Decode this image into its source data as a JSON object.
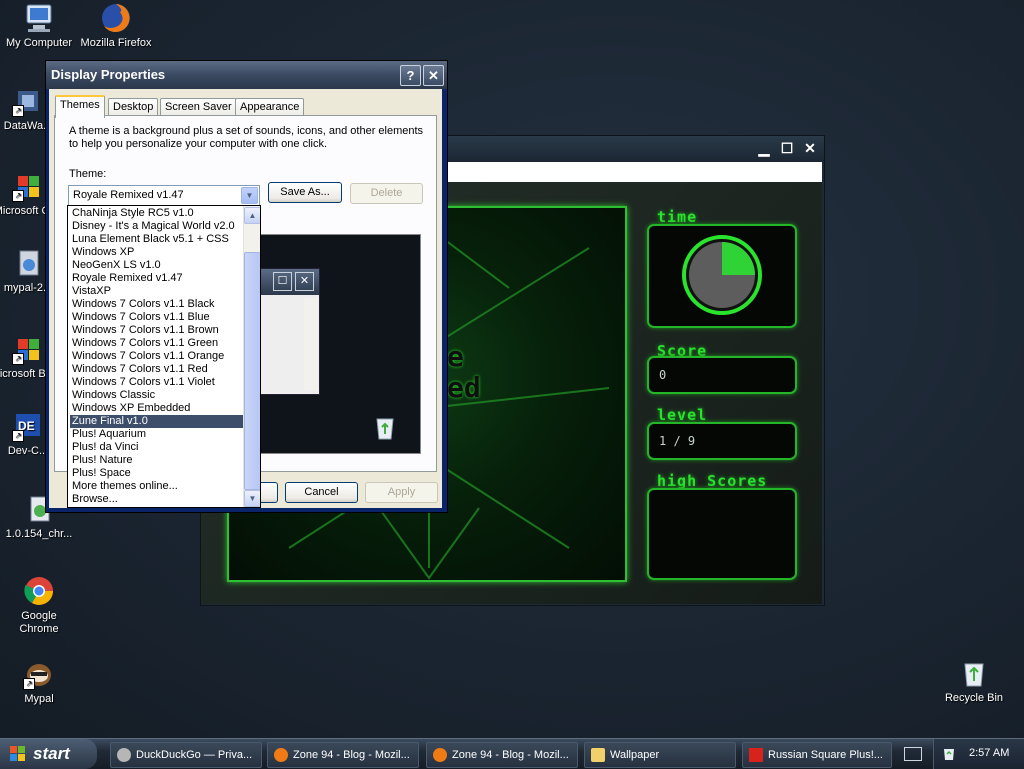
{
  "desktop": {
    "icons": [
      {
        "label": "My Computer"
      },
      {
        "label": "Mozilla Firefox"
      },
      {
        "label": "DataWa..."
      },
      {
        "label": "Microsoft C++"
      },
      {
        "label": "mypal-2..."
      },
      {
        "label": "Microsoft Basic"
      },
      {
        "label": "Dev-C..."
      },
      {
        "label": "1.0.154_chr..."
      },
      {
        "label": "Google Chrome"
      },
      {
        "label": "Mypal"
      },
      {
        "label": "Recycle Bin"
      }
    ]
  },
  "game": {
    "board_text": [
      "e",
      "ed"
    ],
    "time_label": "time",
    "score_label": "Score",
    "score_value": "0",
    "level_label": "level",
    "level_value": "1 / 9",
    "highscores_label": "high Scores"
  },
  "dialog": {
    "title": "Display Properties",
    "help_btn": "?",
    "close_btn": "✕",
    "tabs": [
      "Themes",
      "Desktop",
      "Screen Saver",
      "Appearance"
    ],
    "description": "A theme is a background plus a set of sounds, icons, and other elements to help you personalize your computer with one click.",
    "theme_label": "Theme:",
    "theme_value": "Royale Remixed v1.47",
    "save_as": "Save As...",
    "delete": "Delete",
    "ok": "OK",
    "cancel": "Cancel",
    "apply": "Apply"
  },
  "dropdown": {
    "items": [
      "ChaNinja Style RC5 v1.0",
      "Disney - It's a Magical World v2.0",
      "Luna Element Black v5.1 + CSS",
      "Windows XP",
      "NeoGenX LS v1.0",
      "Royale Remixed v1.47",
      "VistaXP",
      "Windows 7 Colors v1.1 Black",
      "Windows 7 Colors v1.1 Blue",
      "Windows 7 Colors v1.1 Brown",
      "Windows 7 Colors v1.1 Green",
      "Windows 7 Colors v1.1 Orange",
      "Windows 7 Colors v1.1 Red",
      "Windows 7 Colors v1.1 Violet",
      "Windows Classic",
      "Windows XP Embedded",
      "Zune Final v1.0",
      "Plus! Aquarium",
      "Plus! da Vinci",
      "Plus! Nature",
      "Plus! Space",
      "More themes online...",
      "Browse..."
    ],
    "selected": "Zune Final v1.0"
  },
  "taskbar": {
    "start": "start",
    "tasks": [
      {
        "label": "DuckDuckGo — Priva..."
      },
      {
        "label": "Zone 94 - Blog - Mozil..."
      },
      {
        "label": "Zone 94 - Blog - Mozil..."
      },
      {
        "label": "Wallpaper"
      },
      {
        "label": "Russian Square Plus!..."
      }
    ],
    "clock": "2:57 AM"
  },
  "colors": {
    "accent_green": "#29e32c",
    "selection": "#3c4e69",
    "xp_tab_highlight": "#ffc83c"
  }
}
